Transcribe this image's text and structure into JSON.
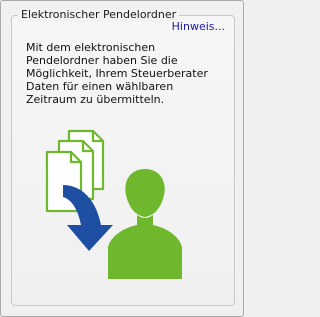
{
  "group": {
    "title": "Elektronischer Pendelordner",
    "link_label": "Hinweis...",
    "description": "Mit dem elektronischen Pendelordner haben Sie die Möglichkeit, Ihrem Steuerberater Daten für einen wählbaren Zeitraum zu übermitteln."
  },
  "illustration": {
    "documents_icon": "documents-icon",
    "arrow_icon": "arrow-icon",
    "person_icon": "person-icon",
    "colors": {
      "green": "#6fb82e",
      "blue": "#1f4fa3",
      "paper": "#ffffff"
    }
  }
}
